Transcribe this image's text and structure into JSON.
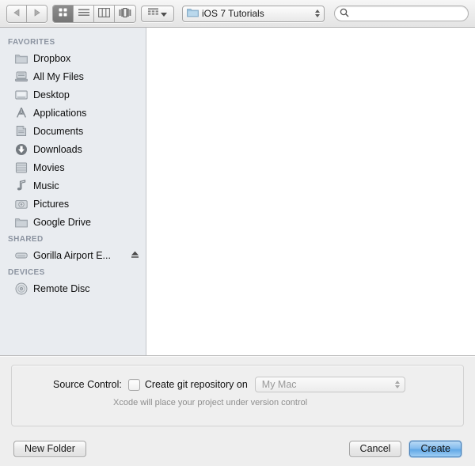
{
  "toolbar": {
    "nav_back_icon": "triangle-left-icon",
    "nav_forward_icon": "triangle-right-icon",
    "view_modes": [
      {
        "name": "icon-view",
        "icon": "grid-icon",
        "selected": true
      },
      {
        "name": "list-view",
        "icon": "list-icon",
        "selected": false
      },
      {
        "name": "column-view",
        "icon": "columns-icon",
        "selected": false
      },
      {
        "name": "coverflow-view",
        "icon": "coverflow-icon",
        "selected": false
      }
    ],
    "arrange": {
      "icon": "arrange-grid-icon",
      "chevron": "chevron-down-icon"
    },
    "path_popup": {
      "folder_icon": "folder-icon",
      "label": "iOS 7 Tutorials"
    },
    "search": {
      "icon": "search-icon",
      "value": "",
      "placeholder": ""
    }
  },
  "sidebar": {
    "sections": [
      {
        "header": "FAVORITES",
        "items": [
          {
            "label": "Dropbox",
            "icon": "folder-icon"
          },
          {
            "label": "All My Files",
            "icon": "all-my-files-icon"
          },
          {
            "label": "Desktop",
            "icon": "desktop-icon"
          },
          {
            "label": "Applications",
            "icon": "applications-icon"
          },
          {
            "label": "Documents",
            "icon": "documents-icon"
          },
          {
            "label": "Downloads",
            "icon": "downloads-icon"
          },
          {
            "label": "Movies",
            "icon": "movies-icon"
          },
          {
            "label": "Music",
            "icon": "music-note-icon"
          },
          {
            "label": "Pictures",
            "icon": "pictures-camera-icon"
          },
          {
            "label": "Google Drive",
            "icon": "folder-icon"
          }
        ]
      },
      {
        "header": "SHARED",
        "items": [
          {
            "label": "Gorilla Airport E...",
            "icon": "shared-server-icon",
            "eject_icon": "eject-icon"
          }
        ]
      },
      {
        "header": "DEVICES",
        "items": [
          {
            "label": "Remote Disc",
            "icon": "disc-icon"
          }
        ]
      }
    ]
  },
  "accessory": {
    "source_control_label": "Source Control:",
    "checkbox_checked": false,
    "checkbox_text": "Create git repository on",
    "location_popup": {
      "value": "My Mac",
      "disabled": true
    },
    "hint": "Xcode will place your project under version control"
  },
  "footer": {
    "new_folder_label": "New Folder",
    "cancel_label": "Cancel",
    "create_label": "Create"
  },
  "colors": {
    "sidebar_bg": "#e9ecf0",
    "panel_bg": "#eeeeee",
    "default_button_blue": "#62a8e6",
    "header_text": "#8b93a0"
  }
}
